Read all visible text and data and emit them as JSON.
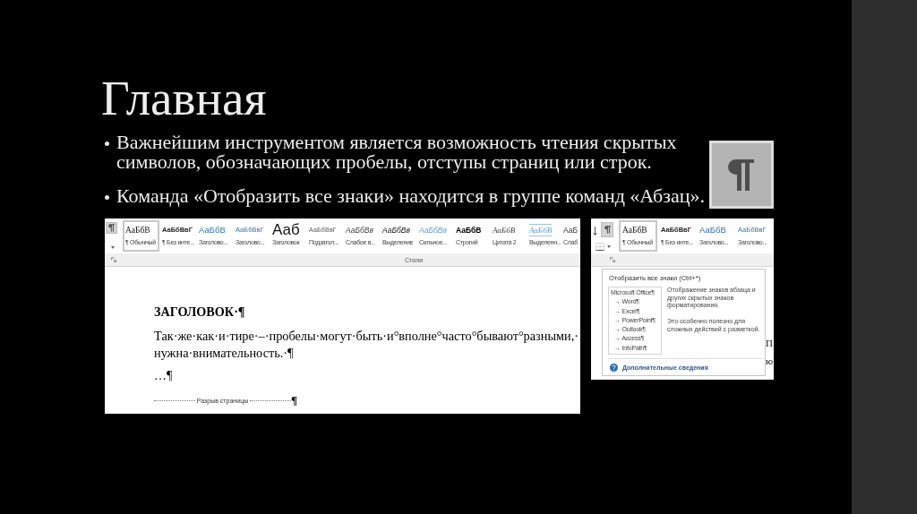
{
  "slide": {
    "title": "Главная",
    "bullets": [
      "Важнейшим инструментом является возможность чтения скрытых символов, обозначающих пробелы, отступы страниц или строк.",
      "Команда «Отобразить все знаки» находится в группе команд «Абзац»."
    ]
  },
  "screenshot_left": {
    "ribbon": {
      "show_marks_button": {
        "selected": true
      },
      "styles": [
        {
          "preview": "АаБбВ",
          "label": "¶ Обычный",
          "kind": "normal",
          "selected": true
        },
        {
          "preview": "АаБбВвГ",
          "label": "¶ Без инте...",
          "kind": "nospacing",
          "selected": false
        },
        {
          "preview": "АаБбВ",
          "label": "Заголово...",
          "kind": "heading1",
          "selected": false
        },
        {
          "preview": "АаБбВвГ",
          "label": "Заголово...",
          "kind": "heading2",
          "selected": false
        },
        {
          "preview": "Ааб",
          "label": "Заголовок",
          "kind": "title",
          "selected": false
        },
        {
          "preview": "АаБбВвГ",
          "label": "Подзагол...",
          "kind": "subtitle",
          "selected": false
        },
        {
          "preview": "АаБбВв",
          "label": "Слабое в...",
          "kind": "subtle",
          "selected": false
        },
        {
          "preview": "АаБбВв",
          "label": "Выделение",
          "kind": "emphasis",
          "selected": false
        },
        {
          "preview": "АаБбВв",
          "label": "Сильное...",
          "kind": "intense",
          "selected": false
        },
        {
          "preview": "АаБбВ",
          "label": "Строгий",
          "kind": "strong",
          "selected": false
        },
        {
          "preview": "АаБбВ",
          "label": "Цитата 2",
          "kind": "quote",
          "selected": false
        },
        {
          "preview": "АаБбВ",
          "label": "Выделенн...",
          "kind": "intensequote",
          "selected": false
        },
        {
          "preview": "АаБ",
          "label": "Слаб",
          "kind": "reference",
          "selected": false
        }
      ],
      "group_label": "Стили"
    },
    "document": {
      "heading": "ЗАГОЛОВОК·¶",
      "paragraph": "Так·же·как·и·тире·–·пробелы·могут·быть·и°вполне°часто°бывают°разными,·\nнужна·внимательность.·¶",
      "ellipsis_line": "…¶",
      "page_break": {
        "label": "Разрыв страницы",
        "mark": "¶"
      }
    }
  },
  "screenshot_right": {
    "ribbon": {
      "show_marks_button": {
        "selected": true
      },
      "styles": [
        {
          "preview": "АаБбВ",
          "label": "¶ Обычный",
          "kind": "normal",
          "selected": true
        },
        {
          "preview": "АаБбВвГ",
          "label": "¶ Без инте...",
          "kind": "nospacing",
          "selected": false
        },
        {
          "preview": "АаБбВ",
          "label": "Заголово...",
          "kind": "heading1",
          "selected": false
        },
        {
          "preview": "АаБбВвГ",
          "label": "Заголово...",
          "kind": "heading2",
          "selected": false
        }
      ]
    },
    "tooltip": {
      "title": "Отобразить все знаки (Ctrl+*)",
      "preview": {
        "text": "Microsoft Office¶",
        "children": [
          {
            "text": "→ Word¶"
          },
          {
            "text": "→ Excel¶"
          },
          {
            "text": "→ PowerPoint¶"
          },
          {
            "text": "→ Outlook¶"
          },
          {
            "text": "→ Access¶"
          },
          {
            "text": "→ InfoPath¶"
          }
        ]
      },
      "description": [
        "Отображение знаков абзаца и других скрытых знаков форматирования.",
        "Это особенно полезно для сложных действий с разметкой."
      ],
      "link": "Дополнительные сведения"
    },
    "document_fragments": [
      "П",
      "ю"
    ]
  }
}
